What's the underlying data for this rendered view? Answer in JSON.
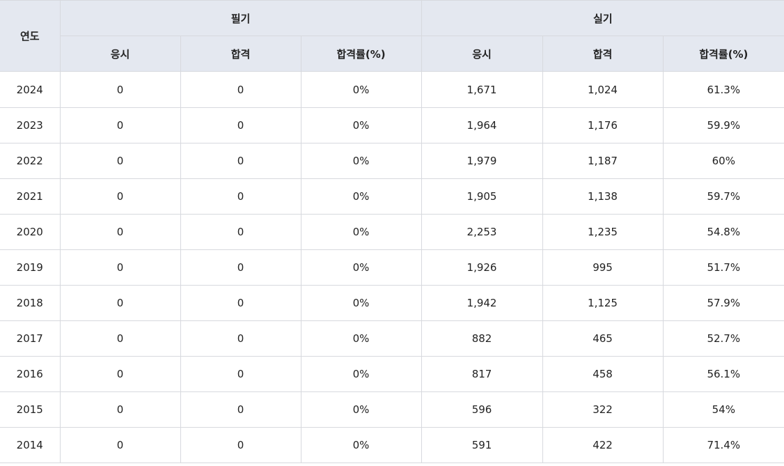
{
  "table": {
    "header": {
      "year": "연도",
      "written": "필기",
      "practical": "실기",
      "sub": [
        "응시",
        "합격",
        "합격률(%)",
        "응시",
        "합격",
        "합격률(%)"
      ]
    },
    "rows": [
      [
        "2024",
        "0",
        "0",
        "0%",
        "1,671",
        "1,024",
        "61.3%"
      ],
      [
        "2023",
        "0",
        "0",
        "0%",
        "1,964",
        "1,176",
        "59.9%"
      ],
      [
        "2022",
        "0",
        "0",
        "0%",
        "1,979",
        "1,187",
        "60%"
      ],
      [
        "2021",
        "0",
        "0",
        "0%",
        "1,905",
        "1,138",
        "59.7%"
      ],
      [
        "2020",
        "0",
        "0",
        "0%",
        "2,253",
        "1,235",
        "54.8%"
      ],
      [
        "2019",
        "0",
        "0",
        "0%",
        "1,926",
        "995",
        "51.7%"
      ],
      [
        "2018",
        "0",
        "0",
        "0%",
        "1,942",
        "1,125",
        "57.9%"
      ],
      [
        "2017",
        "0",
        "0",
        "0%",
        "882",
        "465",
        "52.7%"
      ],
      [
        "2016",
        "0",
        "0",
        "0%",
        "817",
        "458",
        "56.1%"
      ],
      [
        "2015",
        "0",
        "0",
        "0%",
        "596",
        "322",
        "54%"
      ],
      [
        "2014",
        "0",
        "0",
        "0%",
        "591",
        "422",
        "71.4%"
      ]
    ]
  },
  "colors": {
    "header_bg": "#e4e8f0",
    "border": "#d7d9de",
    "top_border": "#222222",
    "text": "#222222"
  }
}
